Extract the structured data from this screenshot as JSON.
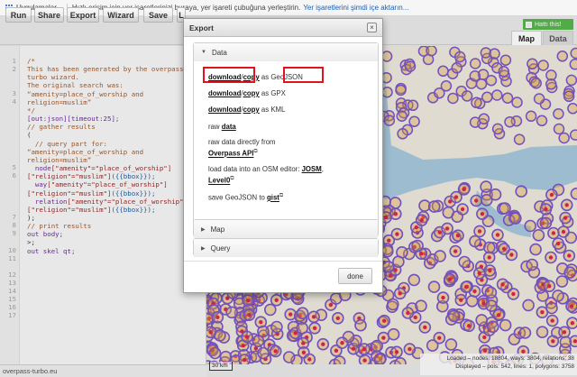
{
  "bookmarks_bar": {
    "apps_label": "Uygulamalar",
    "hint": "Hızlı erişim için yer işaretlerinizi buraya, yer işareti çubuğuna yerleştirin.",
    "import_link": "Yer işaretlerini şimdi içe aktarın..."
  },
  "toolbar": {
    "buttons": [
      "Run",
      "Share",
      "Export",
      "Wizard",
      "Save",
      "L"
    ],
    "hatti_label": "Hattı this!",
    "tabs": [
      "Map",
      "Data"
    ]
  },
  "editor": {
    "line_numbers": [
      "1",
      "2",
      "3",
      "4",
      "5",
      "6",
      "7",
      "8",
      "9",
      "10",
      "11",
      "12",
      "13",
      "14",
      "15",
      "16",
      "17"
    ],
    "lines": [
      {
        "parts": [
          {
            "t": "/*",
            "c": "com"
          }
        ]
      },
      {
        "parts": [
          {
            "t": "This has been generated by the overpass-",
            "c": "com"
          }
        ]
      },
      {
        "parts": [
          {
            "t": "turbo wizard.",
            "c": "com"
          }
        ]
      },
      {
        "parts": [
          {
            "t": "The original search was:",
            "c": "com"
          }
        ]
      },
      {
        "parts": [
          {
            "t": "“amenity=place_of_worship and",
            "c": "com"
          }
        ]
      },
      {
        "parts": [
          {
            "t": "religion=muslim”",
            "c": "com"
          }
        ]
      },
      {
        "parts": [
          {
            "t": "*/",
            "c": "com"
          }
        ]
      },
      {
        "parts": [
          {
            "t": "[out:json][timeout:25];",
            "c": "kw"
          }
        ]
      },
      {
        "parts": [
          {
            "t": "// gather results",
            "c": "com"
          }
        ]
      },
      {
        "parts": [
          {
            "t": "(",
            "c": "txt"
          }
        ]
      },
      {
        "parts": [
          {
            "t": "  // query part for:",
            "c": "com"
          }
        ]
      },
      {
        "parts": [
          {
            "t": "“amenity=place_of_worship and",
            "c": "com"
          }
        ]
      },
      {
        "parts": [
          {
            "t": "religion=muslim”",
            "c": "com"
          }
        ]
      },
      {
        "parts": [
          {
            "t": "  node",
            "c": "kw"
          },
          {
            "t": "[\"amenity\"=\"place_of_worship\"]",
            "c": "str"
          }
        ]
      },
      {
        "parts": [
          {
            "t": "[\"religion\"=\"muslim\"]",
            "c": "str"
          },
          {
            "t": "({{bbox}});",
            "c": "br"
          }
        ]
      },
      {
        "parts": [
          {
            "t": "  way",
            "c": "kw"
          },
          {
            "t": "[\"amenity\"=\"place_of_worship\"]",
            "c": "str"
          }
        ]
      },
      {
        "parts": [
          {
            "t": "[\"religion\"=\"muslim\"]",
            "c": "str"
          },
          {
            "t": "({{bbox}});",
            "c": "br"
          }
        ]
      },
      {
        "parts": [
          {
            "t": "  relation",
            "c": "kw"
          },
          {
            "t": "[\"amenity\"=\"place_of_worship\"",
            "c": "str"
          }
        ]
      },
      {
        "parts": [
          {
            "t": "[\"religion\"=\"muslim\"]",
            "c": "str"
          },
          {
            "t": "({{bbox}});",
            "c": "br"
          }
        ]
      },
      {
        "parts": [
          {
            "t": ");",
            "c": "txt"
          }
        ]
      },
      {
        "parts": [
          {
            "t": "// print results",
            "c": "com"
          }
        ]
      },
      {
        "parts": [
          {
            "t": "out body;",
            "c": "kw"
          }
        ]
      },
      {
        "parts": [
          {
            "t": ">;",
            "c": "txt"
          }
        ]
      },
      {
        "parts": [
          {
            "t": "out skel qt;",
            "c": "kw"
          }
        ]
      }
    ]
  },
  "status_left": "overpass-turbo.eu",
  "map": {
    "scale_label": "30 km",
    "info_line1": "Loaded – nodes: 18804, ways: 3804, relations: 38",
    "info_line2": "Displayed – pois: 542, lines: 1, polygons: 3758"
  },
  "export_dialog": {
    "title": "Export",
    "close_glyph": "×",
    "sections": [
      "Data",
      "Map",
      "Query"
    ],
    "rows": [
      {
        "a": "download",
        "sep": "/",
        "b": "copy",
        "tail": " as ",
        "fmt": "GeoJSON"
      },
      {
        "a": "download",
        "sep": "/",
        "b": "copy",
        "tail": " as GPX"
      },
      {
        "a": "download",
        "sep": "/",
        "b": "copy",
        "tail": " as KML"
      }
    ],
    "raw_label": "raw ",
    "raw_link": "data",
    "raw_direct_label": "raw data directly from",
    "raw_direct_link": "Overpass API",
    "osm_label": "load data into an OSM editor: ",
    "osm_link1": "JOSM",
    "osm_link2": "Level0",
    "gist_label": "save GeoJSON to ",
    "gist_link": "gist",
    "done_label": "done"
  }
}
